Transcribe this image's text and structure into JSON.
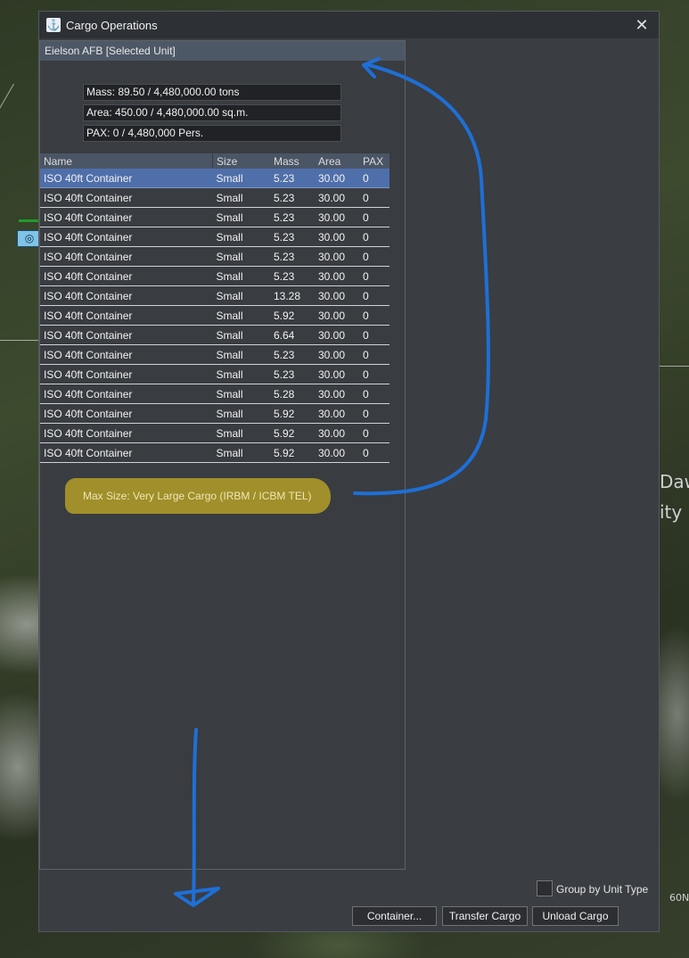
{
  "map": {
    "labels": [
      "Daw",
      "ity",
      "60N"
    ]
  },
  "window": {
    "title": "Cargo Operations",
    "close_glyph": "✕",
    "icon": "cargo-app-icon"
  },
  "unit": {
    "header": "Eielson AFB [Selected Unit]"
  },
  "stats": {
    "mass": "Mass: 89.50 / 4,480,000.00 tons",
    "area": "Area: 450.00 / 4,480,000.00 sq.m.",
    "pax": "PAX: 0 / 4,480,000 Pers."
  },
  "table": {
    "headers": [
      "Name",
      "Size",
      "Mass",
      "Area",
      "PAX"
    ],
    "rows": [
      [
        "ISO 40ft Container",
        "Small",
        "5.23",
        "30.00",
        "0"
      ],
      [
        "ISO 40ft Container",
        "Small",
        "5.23",
        "30.00",
        "0"
      ],
      [
        "ISO 40ft Container",
        "Small",
        "5.23",
        "30.00",
        "0"
      ],
      [
        "ISO 40ft Container",
        "Small",
        "5.23",
        "30.00",
        "0"
      ],
      [
        "ISO 40ft Container",
        "Small",
        "5.23",
        "30.00",
        "0"
      ],
      [
        "ISO 40ft Container",
        "Small",
        "5.23",
        "30.00",
        "0"
      ],
      [
        "ISO 40ft Container",
        "Small",
        "13.28",
        "30.00",
        "0"
      ],
      [
        "ISO 40ft Container",
        "Small",
        "5.92",
        "30.00",
        "0"
      ],
      [
        "ISO 40ft Container",
        "Small",
        "6.64",
        "30.00",
        "0"
      ],
      [
        "ISO 40ft Container",
        "Small",
        "5.23",
        "30.00",
        "0"
      ],
      [
        "ISO 40ft Container",
        "Small",
        "5.23",
        "30.00",
        "0"
      ],
      [
        "ISO 40ft Container",
        "Small",
        "5.28",
        "30.00",
        "0"
      ],
      [
        "ISO 40ft Container",
        "Small",
        "5.92",
        "30.00",
        "0"
      ],
      [
        "ISO 40ft Container",
        "Small",
        "5.92",
        "30.00",
        "0"
      ],
      [
        "ISO 40ft Container",
        "Small",
        "5.92",
        "30.00",
        "0"
      ]
    ],
    "selected_row": 0
  },
  "max_size": "Max Size: Very Large Cargo (IRBM / ICBM TEL)",
  "footer": {
    "group_label": "Group by Unit Type",
    "group_checked": false,
    "container_button": "Container...",
    "transfer_button": "Transfer Cargo",
    "unload_button": "Unload Cargo"
  },
  "colors": {
    "annotation_arrow": "#1e6fd6",
    "highlight": "#a08f2a",
    "selected_row": "#4f6faa"
  }
}
